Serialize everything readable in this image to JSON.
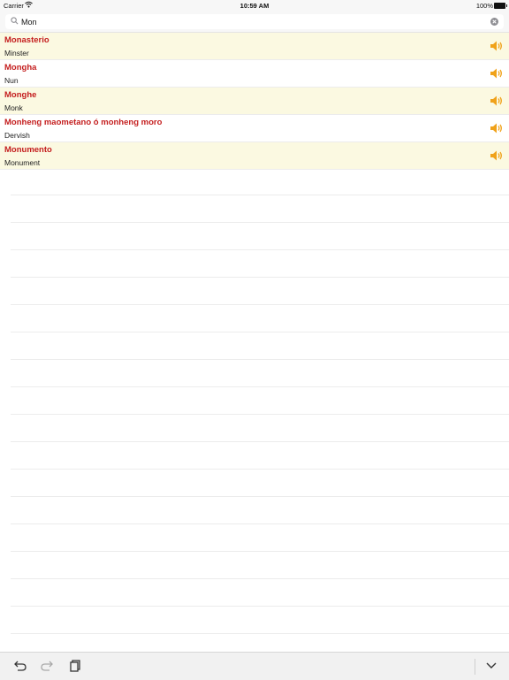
{
  "status_bar": {
    "carrier": "Carrier",
    "time": "10:59 AM",
    "battery": "100%"
  },
  "search": {
    "value": "Mon",
    "icon": "search-icon",
    "clear_icon": "clear-icon"
  },
  "results": [
    {
      "term": "Monasterio",
      "translation": "Minster"
    },
    {
      "term": "Mongha",
      "translation": "Nun"
    },
    {
      "term": "Monghe",
      "translation": "Monk"
    },
    {
      "term": "Monheng maometano ó monheng moro",
      "translation": "Dervish"
    },
    {
      "term": "Monumento",
      "translation": "Monument"
    }
  ],
  "colors": {
    "term": "#c41e1e",
    "row_highlight": "#fbf9e1",
    "speaker": "#f0a21a"
  },
  "toolbar": {
    "icons": [
      "undo-icon",
      "redo-icon",
      "copy-icon",
      "chevron-down-icon"
    ]
  }
}
